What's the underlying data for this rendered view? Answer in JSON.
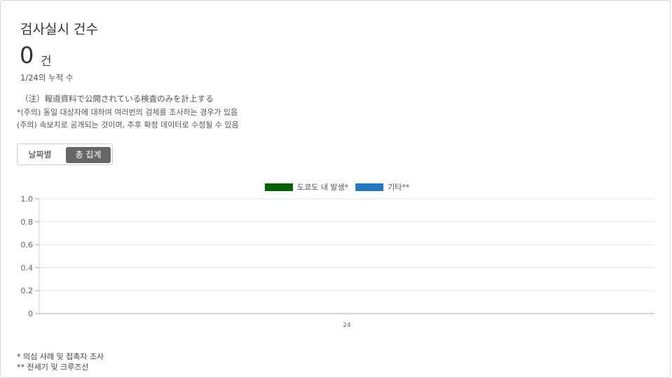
{
  "header": {
    "title": "검사실시 건수",
    "count": "0",
    "unit": "건",
    "subtitle": "1/24의 누적 수"
  },
  "notes": [
    "（注）報道資料で公開されている検査のみを計上する",
    "*(주의) 동일 대상자에 대하여 여러번의 검체를 조사하는 경우가 있음",
    "(주의) 속보치로 공개되는 것이며, 추후 확정 데이터로 수정될 수 있음"
  ],
  "toggle": {
    "daily_label": "날짜별",
    "total_label": "총 집계",
    "selected": "total"
  },
  "chart_data": {
    "type": "bar",
    "categories": [
      "24"
    ],
    "series": [
      {
        "name": "도쿄도 내 발생*",
        "values": [
          0
        ],
        "color": "#006400"
      },
      {
        "name": "기타**",
        "values": [
          0
        ],
        "color": "#1f77c7"
      }
    ],
    "ylim": [
      0,
      1.0
    ],
    "yticks": [
      "0",
      "0.2",
      "0.4",
      "0.6",
      "0.8",
      "1.0"
    ],
    "grid": true,
    "legend_position": "top-center",
    "stacked": true
  },
  "footnotes": [
    "* 의심 사례 및 접촉자 조사",
    "** 전세기 및 크루즈선"
  ]
}
